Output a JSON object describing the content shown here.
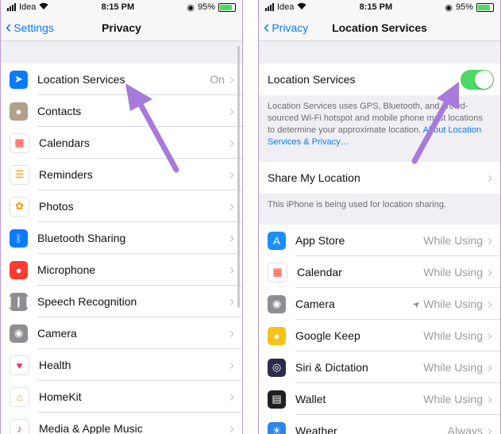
{
  "left": {
    "status": {
      "carrier": "Idea",
      "time": "8:15 PM",
      "battery": "95%"
    },
    "nav": {
      "back": "Settings",
      "title": "Privacy"
    },
    "items": [
      {
        "label": "Location Services",
        "value": "On",
        "icon": "location-arrow-icon",
        "color": "#0a7aff"
      },
      {
        "label": "Contacts",
        "value": "",
        "icon": "contacts-icon",
        "color": "#b1a08a"
      },
      {
        "label": "Calendars",
        "value": "",
        "icon": "calendar-icon",
        "color": "#ffffff"
      },
      {
        "label": "Reminders",
        "value": "",
        "icon": "reminders-icon",
        "color": "#ffffff"
      },
      {
        "label": "Photos",
        "value": "",
        "icon": "photos-icon",
        "color": "#ffffff"
      },
      {
        "label": "Bluetooth Sharing",
        "value": "",
        "icon": "bluetooth-icon",
        "color": "#0a7aff"
      },
      {
        "label": "Microphone",
        "value": "",
        "icon": "microphone-icon",
        "color": "#ff3b30"
      },
      {
        "label": "Speech Recognition",
        "value": "",
        "icon": "waveform-icon",
        "color": "#8e8e93"
      },
      {
        "label": "Camera",
        "value": "",
        "icon": "camera-icon",
        "color": "#8e8e93"
      },
      {
        "label": "Health",
        "value": "",
        "icon": "heart-icon",
        "color": "#ffffff"
      },
      {
        "label": "HomeKit",
        "value": "",
        "icon": "home-icon",
        "color": "#ffffff"
      },
      {
        "label": "Media & Apple Music",
        "value": "",
        "icon": "music-note-icon",
        "color": "#ffffff"
      }
    ]
  },
  "right": {
    "status": {
      "carrier": "Idea",
      "time": "8:15 PM",
      "battery": "95%"
    },
    "nav": {
      "back": "Privacy",
      "title": "Location Services"
    },
    "location_toggle_label": "Location Services",
    "toggle_on": true,
    "note_text": "Location Services uses GPS, Bluetooth, and crowd-sourced Wi-Fi hotspot and mobile phone mast locations to determine your approximate location.",
    "note_link": "About Location Services & Privacy…",
    "share_label": "Share My Location",
    "share_note": "This iPhone is being used for location sharing.",
    "apps": [
      {
        "label": "App Store",
        "value": "While Using",
        "icon": "app-store-icon",
        "color": "#1c8ef9",
        "arrow": false
      },
      {
        "label": "Calendar",
        "value": "While Using",
        "icon": "calendar-icon",
        "color": "#ffffff",
        "arrow": false
      },
      {
        "label": "Camera",
        "value": "While Using",
        "icon": "camera-icon",
        "color": "#8e8e93",
        "arrow": true
      },
      {
        "label": "Google Keep",
        "value": "While Using",
        "icon": "keep-bulb-icon",
        "color": "#f9c11a",
        "arrow": false
      },
      {
        "label": "Siri & Dictation",
        "value": "While Using",
        "icon": "siri-icon",
        "color": "#2b2b4a",
        "arrow": false
      },
      {
        "label": "Wallet",
        "value": "While Using",
        "icon": "wallet-icon",
        "color": "#1f1f1f",
        "arrow": false
      },
      {
        "label": "Weather",
        "value": "Always",
        "icon": "weather-icon",
        "color": "#2d86e6",
        "arrow": false
      }
    ]
  }
}
